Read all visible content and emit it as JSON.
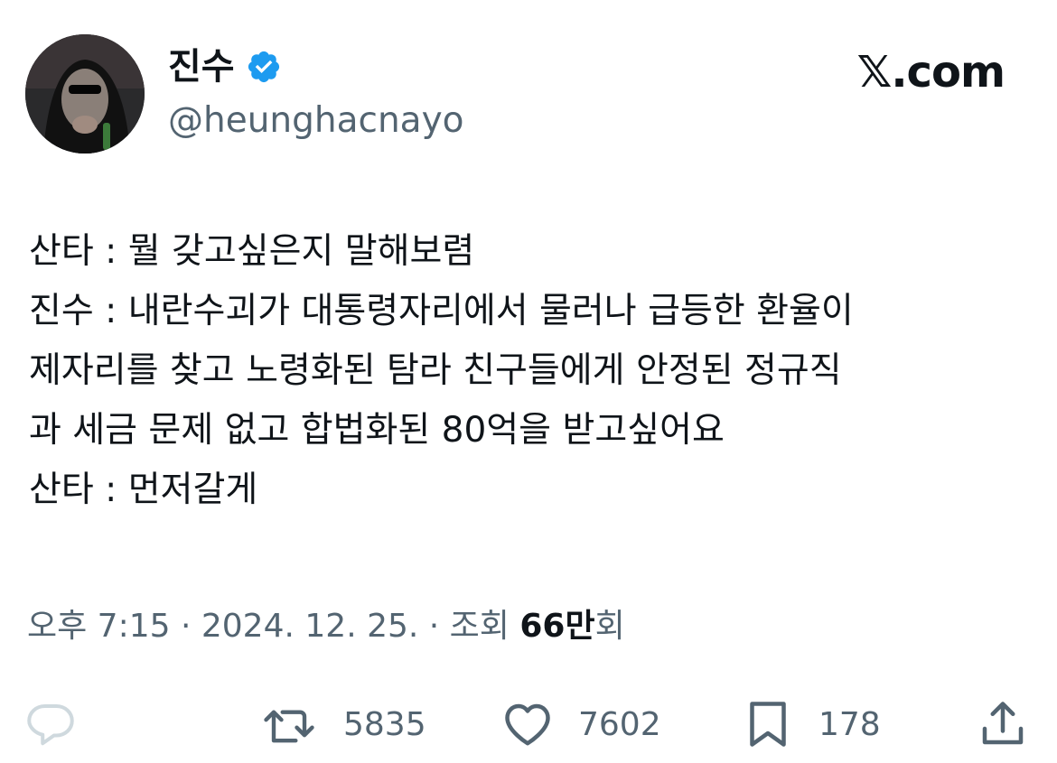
{
  "author": {
    "display_name": "진수",
    "handle": "@heunghacnayo",
    "verified": true,
    "verified_color": "#1d9bf0",
    "avatar_icon": "avatar-photo"
  },
  "brand": "𝕏.com",
  "tweet": {
    "lines": [
      "산타 : 뭘 갖고싶은지 말해보렴",
      "진수 : 내란수괴가 대통령자리에서 물러나 급등한 환율이",
      "제자리를 찾고 노령화된 탐라 친구들에게 안정된 정규직",
      "과 세금 문제 없고 합법화된 80억을 받고싶어요",
      "산타 : 먼저갈게"
    ]
  },
  "meta": {
    "time": "오후 7:15",
    "separator": " · ",
    "date": "2024. 12. 25.",
    "views_prefix": "조회 ",
    "views_count": "66만",
    "views_suffix": "회"
  },
  "actions": {
    "reply": {
      "icon": "reply-icon",
      "count": ""
    },
    "retweet": {
      "icon": "retweet-icon",
      "count": "5835"
    },
    "like": {
      "icon": "heart-icon",
      "count": "7602"
    },
    "bookmark": {
      "icon": "bookmark-icon",
      "count": "178"
    },
    "share": {
      "icon": "share-icon"
    }
  },
  "colors": {
    "text": "#0f1419",
    "muted": "#536471",
    "background": "#ffffff"
  }
}
